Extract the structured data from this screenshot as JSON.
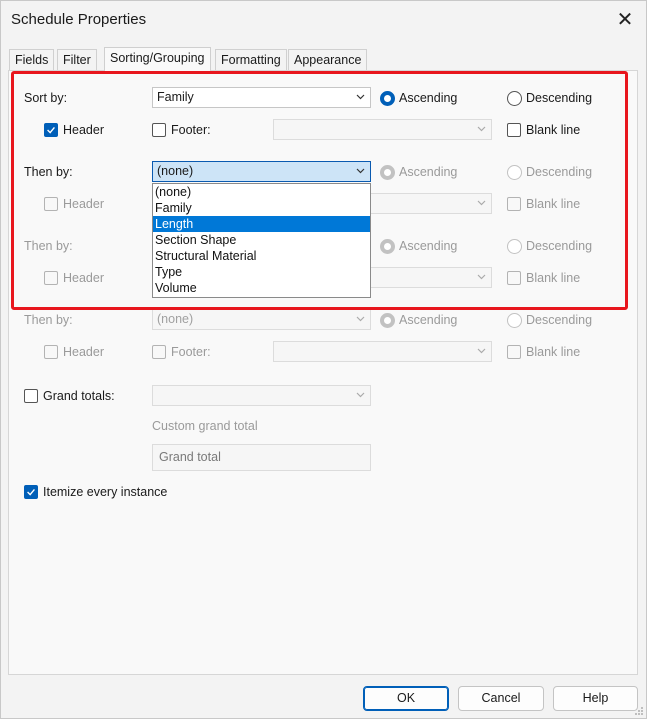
{
  "window": {
    "title": "Schedule Properties"
  },
  "tabs": [
    {
      "label": "Fields"
    },
    {
      "label": "Filter"
    },
    {
      "label": "Sorting/Grouping"
    },
    {
      "label": "Formatting"
    },
    {
      "label": "Appearance"
    }
  ],
  "sort_by": {
    "label": "Sort by:",
    "value": "Family",
    "ascending": "Ascending",
    "descending": "Descending",
    "header": "Header",
    "footer": "Footer:",
    "blank_line": "Blank line"
  },
  "then_by_1": {
    "label": "Then by:",
    "value": "(none)",
    "ascending": "Ascending",
    "descending": "Descending",
    "header": "Header",
    "blank_line": "Blank line"
  },
  "then_by_2": {
    "label": "Then by:",
    "ascending": "Ascending",
    "descending": "Descending",
    "header": "Header",
    "blank_line": "Blank line"
  },
  "then_by_3": {
    "label": "Then by:",
    "value": "(none)",
    "ascending": "Ascending",
    "descending": "Descending",
    "header": "Header",
    "footer": "Footer:",
    "blank_line": "Blank line"
  },
  "dropdown_options": [
    "(none)",
    "Family",
    "Length",
    "Section Shape",
    "Structural Material",
    "Type",
    "Volume"
  ],
  "dropdown_selected": "Length",
  "grand_totals": {
    "label": "Grand totals:",
    "custom_label": "Custom grand total",
    "value": "Grand total"
  },
  "itemize": {
    "label": "Itemize every instance",
    "checked": true
  },
  "buttons": {
    "ok": "OK",
    "cancel": "Cancel",
    "help": "Help"
  },
  "colors": {
    "accent": "#005fb8",
    "highlight": "#e8161d",
    "selection": "#0078d7"
  }
}
